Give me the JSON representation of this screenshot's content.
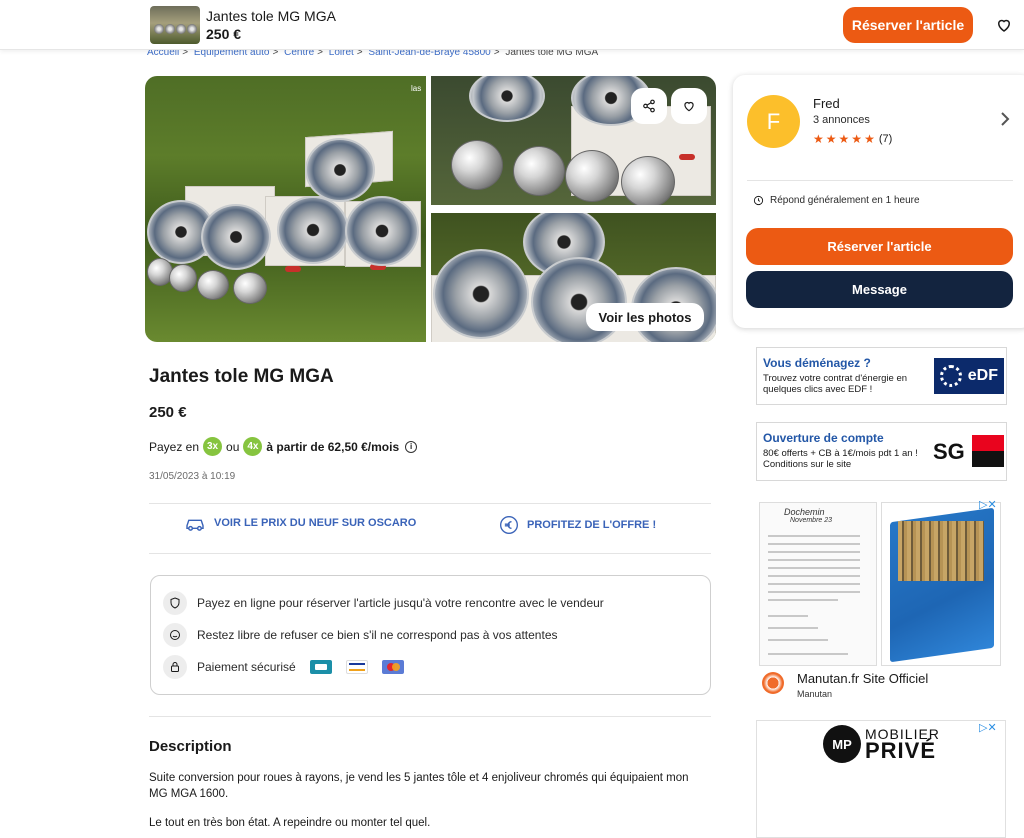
{
  "topbar": {
    "title": "Jantes tole MG MGA",
    "price": "250 €",
    "reserve_label": "Réserver l'article"
  },
  "breadcrumb": [
    "Accueil",
    "Equipement auto",
    "Centre",
    "Loiret",
    "Saint-Jean-de-Braye 45800",
    "Jantes tole MG MGA"
  ],
  "gallery": {
    "see_photos": "Voir les photos",
    "main_corner_text": "las"
  },
  "ad": {
    "title": "Jantes tole MG MGA",
    "price": "250 €",
    "pay_prefix": "Payez en",
    "pay_3x": "3x",
    "pay_or": "ou",
    "pay_4x": "4x",
    "pay_suffix": "à partir de 62,50 €/mois",
    "date": "31/05/2023 à 10:19",
    "promo_oscaro": "VOIR LE PRIX DU NEUF SUR OSCARO",
    "promo_offer": "PROFITEZ DE L'OFFRE !",
    "guarantee": {
      "row1": "Payez en ligne pour réserver l'article jusqu'à votre rencontre avec le vendeur",
      "row2": "Restez libre de refuser ce bien s'il ne correspond pas à vos attentes",
      "row3": "Paiement sécurisé"
    },
    "description_title": "Description",
    "description_p1": "Suite conversion pour roues à rayons, je vend les 5 jantes tôle et 4 enjoliveur chromés qui équipaient mon MG MGA 1600.",
    "description_p2": "Le tout en très bon état. A repeindre ou monter tel quel."
  },
  "seller": {
    "initial": "F",
    "name": "Fred",
    "ads_count": "3 annonces",
    "rating_stars": 5,
    "rating_count": "(7)",
    "response": "Répond généralement en 1 heure",
    "reserve_label": "Réserver l'article",
    "message_label": "Message"
  },
  "ads": {
    "edf": {
      "heading": "Vous déménagez ?",
      "text": "Trouvez votre contrat d'énergie en quelques clics avec EDF !",
      "logo": "eDF"
    },
    "sg": {
      "heading": "Ouverture de compte",
      "text": "80€ offerts + CB à 1€/mois pdt 1 an ! Conditions sur le site",
      "logo": "SG"
    },
    "manutan": {
      "title": "Manutan.fr Site Officiel",
      "sub": "Manutan",
      "doc_line1": "Dochemin",
      "doc_line2": "Novembre 23"
    },
    "mobilier": {
      "circle": "MP",
      "line1": "MOBILIER",
      "line2": "PRIVÉ"
    }
  },
  "colors": {
    "accent": "#ec5a13",
    "navy": "#13243f",
    "link": "#3f6fc9",
    "green_pill": "#86c43f",
    "avatar": "#fcbf2b"
  }
}
